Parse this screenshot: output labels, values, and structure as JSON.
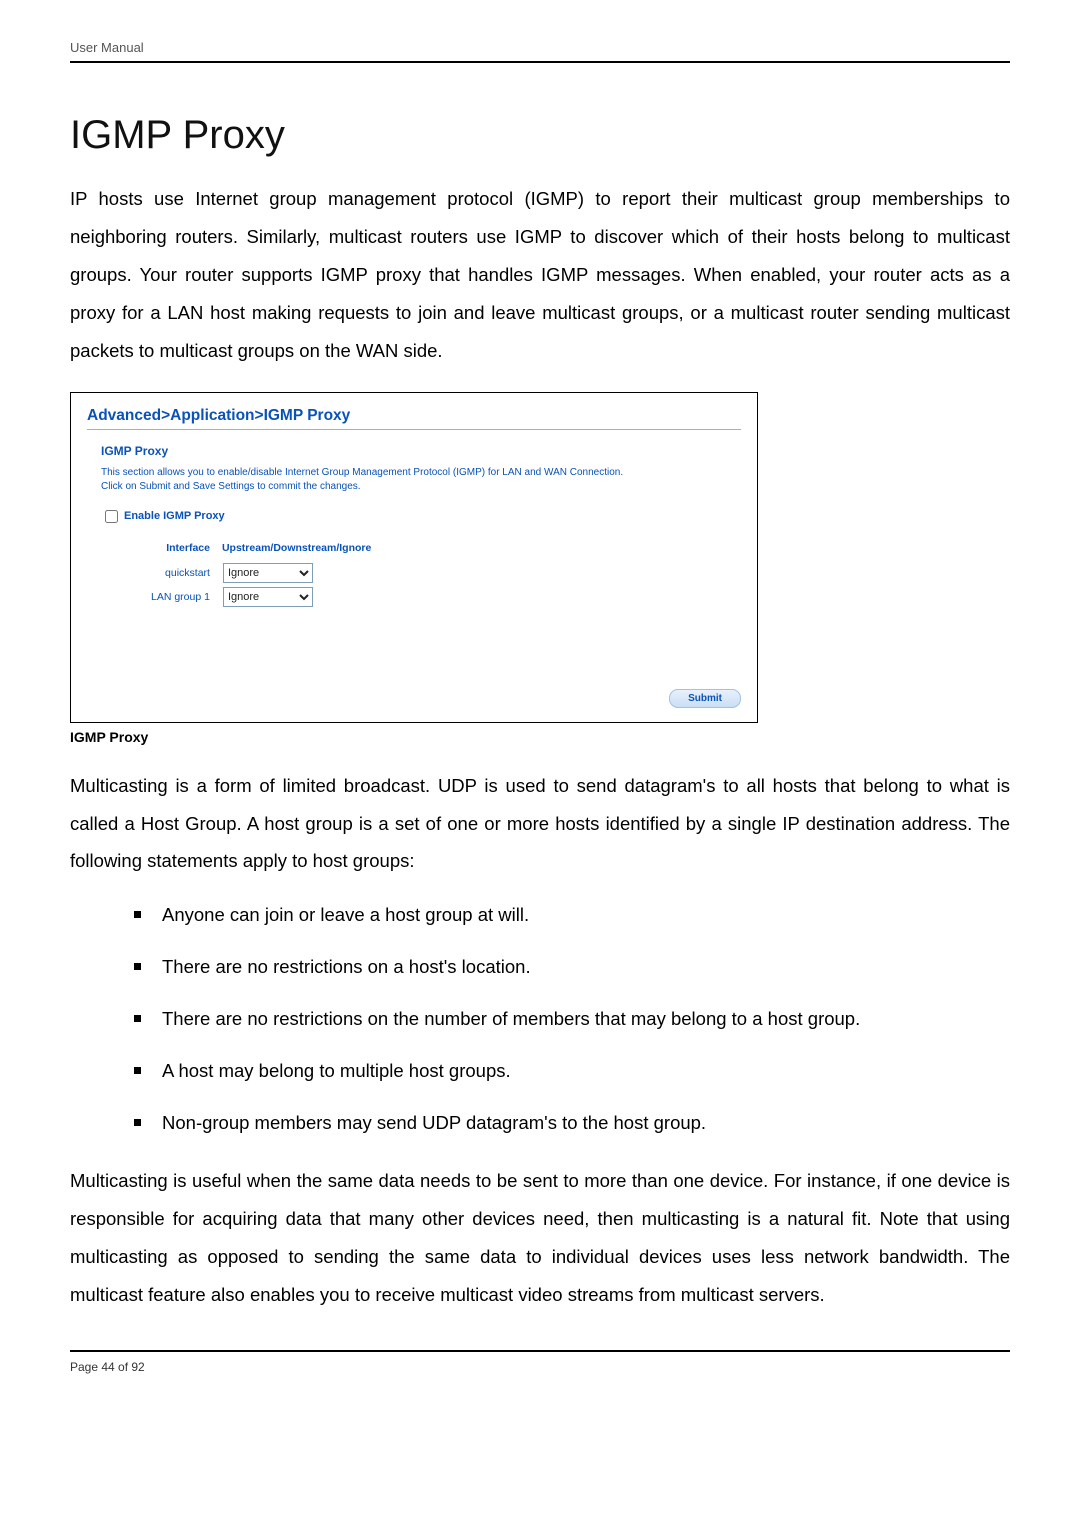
{
  "header": {
    "text": "User Manual"
  },
  "title": "IGMP Proxy",
  "intro": "IP hosts use Internet group management protocol (IGMP) to report their multicast group memberships to neighboring routers. Similarly, multicast routers use IGMP to discover which of their hosts belong to multicast groups. Your router supports IGMP proxy that handles IGMP messages. When enabled, your router acts as a proxy for a LAN host making requests to join and leave multicast groups, or a multicast router sending multicast packets to multicast groups on the WAN side.",
  "panel": {
    "breadcrumb": "Advanced>Application>IGMP Proxy",
    "section_title": "IGMP Proxy",
    "description_line1": "This section allows you to enable/disable Internet Group Management Protocol (IGMP) for LAN and WAN Connection.",
    "description_line2": "Click on Submit and Save Settings to commit the changes.",
    "enable_label": "Enable IGMP Proxy",
    "col_interface": "Interface",
    "col_mode": "Upstream/Downstream/Ignore",
    "rows": [
      {
        "iface": "quickstart",
        "mode": "Ignore"
      },
      {
        "iface": "LAN group 1",
        "mode": "Ignore"
      }
    ],
    "submit_label": "Submit"
  },
  "caption": "IGMP Proxy",
  "para2": "Multicasting is a form of limited broadcast. UDP is used to send datagram's to all hosts that belong to what is called a Host Group. A host group is a set of one or more hosts identified by a single IP destination address. The following statements apply to host groups:",
  "bullets": [
    "Anyone can join or leave a host group at will.",
    "There are no restrictions on a host's location.",
    "There are no restrictions on the number of members that may belong to a host group.",
    "A host may belong to multiple host groups.",
    "Non-group members may send UDP datagram's to the host group."
  ],
  "para3": "Multicasting is useful when the same data needs to be sent to more than one device. For instance, if one device is responsible for acquiring data that many other devices need, then multicasting is a natural fit. Note that using multicasting as opposed to sending the same data to individual devices uses less network bandwidth. The multicast feature also enables you to receive multicast video streams from multicast servers.",
  "footer": {
    "text": "Page 44 of 92"
  }
}
